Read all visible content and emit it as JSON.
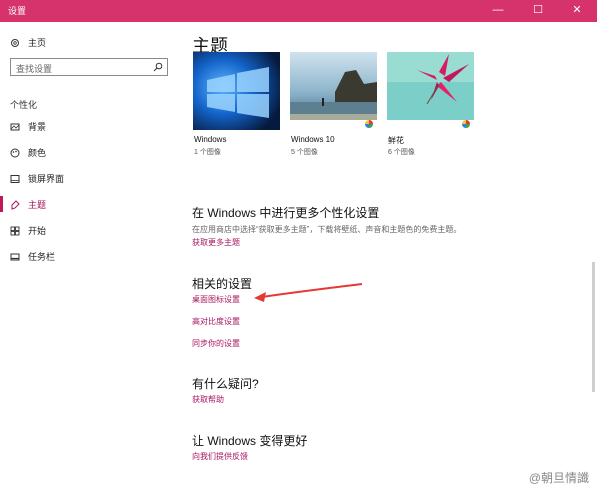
{
  "window": {
    "title": "设置",
    "minimize": "—",
    "maximize": "☐",
    "close": "✕"
  },
  "sidebar": {
    "home_label": "主页",
    "search_placeholder": "查找设置",
    "section": "个性化",
    "items": [
      {
        "label": "背景",
        "icon": "picture-icon"
      },
      {
        "label": "颜色",
        "icon": "palette-icon"
      },
      {
        "label": "锁屏界面",
        "icon": "lock-screen-icon"
      },
      {
        "label": "主题",
        "icon": "brush-icon",
        "active": true
      },
      {
        "label": "开始",
        "icon": "start-icon"
      },
      {
        "label": "任务栏",
        "icon": "taskbar-icon"
      }
    ]
  },
  "main": {
    "title": "主题",
    "themes": [
      {
        "name": "Windows",
        "count": "1 个图像"
      },
      {
        "name": "Windows 10",
        "count": "5 个图像"
      },
      {
        "name": "鲜花",
        "count": "6 个图像"
      }
    ],
    "more": {
      "heading": "在 Windows 中进行更多个性化设置",
      "desc": "在应用商店中选择“获取更多主题”，下载将壁纸、声音和主题色的免费主题。",
      "link": "获取更多主题"
    },
    "related": {
      "heading": "相关的设置",
      "links": [
        "桌面图标设置",
        "高对比度设置",
        "同步你的设置"
      ]
    },
    "question": {
      "heading": "有什么疑问?",
      "link": "获取帮助"
    },
    "better": {
      "heading": "让 Windows 变得更好",
      "link": "向我们提供反馈"
    }
  },
  "watermark": "@朝旦情讖",
  "colors": {
    "accent": "#c2185b",
    "titlebar": "#d6336c",
    "link": "#a8155f",
    "arrow": "#e53935"
  }
}
